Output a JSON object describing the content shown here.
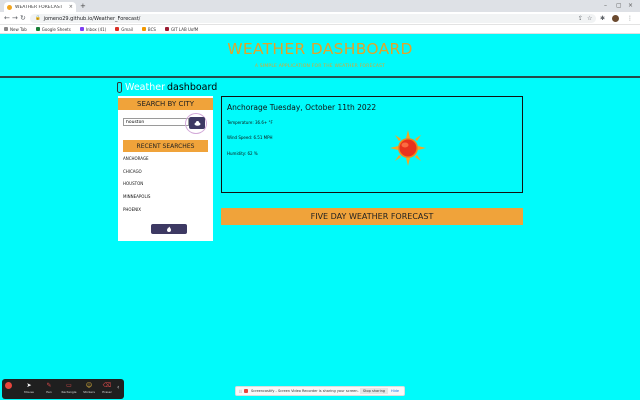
{
  "browser": {
    "tab_title": "WEATHER FORECAST",
    "url": "jomeno29.github.io/Weather_Forecast/",
    "bookmarks": [
      "New Tab",
      "Google Sheets",
      "Inbox (41)",
      "Gmail",
      "BCS",
      "GIT LAB UofM"
    ]
  },
  "header": {
    "title": "WEATHER DASHBOARD",
    "subtitle": "A SIMPLE APPLICATION FOR THE WEATHER FORECAST"
  },
  "logo": {
    "word1": "Weather",
    "word2": "dashboard"
  },
  "sidebar": {
    "search_heading": "SEARCH BY CITY",
    "search_value": "houston",
    "recent_heading": "RECENT SEARCHES",
    "recent": [
      "ANCHORAGE",
      "CHICAGO",
      "HOUSTON",
      "MINNEAPOLIS",
      "PHOENIX"
    ]
  },
  "current": {
    "title": "Anchorage Tuesday, October 11th 2022",
    "temperature": "Temperature: 36.6+ °F",
    "wind": "Wind Speed: 6.51 MPH",
    "humidity": "Humidity: 62 %",
    "icon": "sun-icon"
  },
  "forecast": {
    "heading": "FIVE DAY WEATHER FORECAST"
  },
  "recorder": {
    "tools": [
      "Mouse",
      "Pen",
      "Rectangle",
      "Stickers",
      "Eraser"
    ]
  },
  "share_banner": {
    "text": "Screencastify - Screen Video Recorder is sharing your screen.",
    "stop": "Stop sharing",
    "hide": "Hide"
  },
  "colors": {
    "page_bg": "#00fbfb",
    "accent": "#f0a33a",
    "button": "#3d3963",
    "title": "#e0a52a"
  }
}
